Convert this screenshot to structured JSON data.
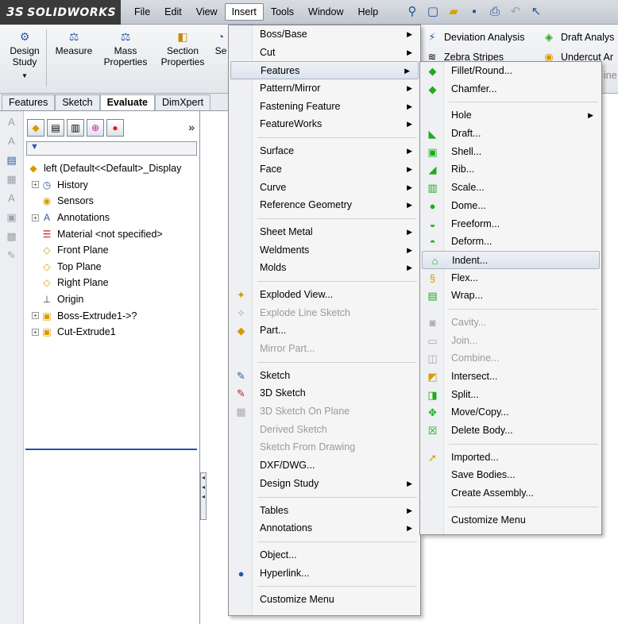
{
  "app": {
    "logo": "SOLIDWORKS",
    "logo_mark": "3S"
  },
  "menubar": [
    "File",
    "Edit",
    "View",
    "Insert",
    "Tools",
    "Window",
    "Help"
  ],
  "active_menu": "Insert",
  "commands": [
    {
      "label": "Design\nStudy"
    },
    {
      "label": "Measure"
    },
    {
      "label": "Mass\nProperties"
    },
    {
      "label": "Section\nProperties"
    },
    {
      "label": "Se"
    }
  ],
  "right_commands": {
    "deviation": "Deviation Analysis",
    "draft": "Draft Analys",
    "zebra": "Zebra Stripes",
    "undercut": "Undercut Ar",
    "partial": "ine"
  },
  "tabs": [
    "Features",
    "Sketch",
    "Evaluate",
    "DimXpert"
  ],
  "active_tab": "Evaluate",
  "fm_more": "»",
  "tree": [
    {
      "label": "left  (Default<<Default>_Display",
      "expander": "",
      "icon": "part-icon"
    },
    {
      "label": "History",
      "expander": "+",
      "icon": "history-icon"
    },
    {
      "label": "Sensors",
      "expander": "",
      "icon": "sensors-icon"
    },
    {
      "label": "Annotations",
      "expander": "+",
      "icon": "annotations-icon"
    },
    {
      "label": "Material <not specified>",
      "expander": "",
      "icon": "material-icon"
    },
    {
      "label": "Front Plane",
      "expander": "",
      "icon": "plane-icon"
    },
    {
      "label": "Top Plane",
      "expander": "",
      "icon": "plane-icon"
    },
    {
      "label": "Right Plane",
      "expander": "",
      "icon": "plane-icon"
    },
    {
      "label": "Origin",
      "expander": "",
      "icon": "origin-icon"
    },
    {
      "label": "Boss-Extrude1->?",
      "expander": "+",
      "icon": "boss-extrude-icon"
    },
    {
      "label": "Cut-Extrude1",
      "expander": "+",
      "icon": "cut-extrude-icon"
    }
  ],
  "insert_menu": [
    {
      "label": "Boss/Base",
      "submenu": true
    },
    {
      "label": "Cut",
      "submenu": true
    },
    {
      "label": "Features",
      "submenu": true,
      "highlight": true
    },
    {
      "label": "Pattern/Mirror",
      "submenu": true
    },
    {
      "label": "Fastening Feature",
      "submenu": true
    },
    {
      "label": "FeatureWorks",
      "submenu": true
    },
    {
      "sep": true
    },
    {
      "label": "Surface",
      "submenu": true
    },
    {
      "label": "Face",
      "submenu": true
    },
    {
      "label": "Curve",
      "submenu": true
    },
    {
      "label": "Reference Geometry",
      "submenu": true
    },
    {
      "sep": true
    },
    {
      "label": "Sheet Metal",
      "submenu": true
    },
    {
      "label": "Weldments",
      "submenu": true
    },
    {
      "label": "Molds",
      "submenu": true
    },
    {
      "sep": true
    },
    {
      "label": "Exploded View...",
      "icon": "exploded-view-icon"
    },
    {
      "label": "Explode Line Sketch",
      "disabled": true,
      "icon": "explode-line-icon"
    },
    {
      "label": "Part...",
      "icon": "part-insert-icon"
    },
    {
      "label": "Mirror Part...",
      "disabled": true
    },
    {
      "sep": true
    },
    {
      "label": "Sketch",
      "icon": "sketch-icon"
    },
    {
      "label": "3D Sketch",
      "icon": "3d-sketch-icon"
    },
    {
      "label": "3D Sketch On Plane",
      "disabled": true,
      "icon": "3d-sketch-plane-icon"
    },
    {
      "label": "Derived Sketch",
      "disabled": true
    },
    {
      "label": "Sketch From Drawing",
      "disabled": true
    },
    {
      "label": "DXF/DWG..."
    },
    {
      "label": "Design Study",
      "submenu": true
    },
    {
      "sep": true
    },
    {
      "label": "Tables",
      "submenu": true
    },
    {
      "label": "Annotations",
      "submenu": true
    },
    {
      "sep": true
    },
    {
      "label": "Object..."
    },
    {
      "label": "Hyperlink...",
      "icon": "hyperlink-icon"
    },
    {
      "sep": true
    },
    {
      "label": "Customize Menu"
    }
  ],
  "features_menu": [
    {
      "label": "Fillet/Round...",
      "icon": "fillet-icon"
    },
    {
      "label": "Chamfer...",
      "icon": "chamfer-icon"
    },
    {
      "sep": true
    },
    {
      "label": "Hole",
      "submenu": true
    },
    {
      "label": "Draft...",
      "icon": "draft-icon"
    },
    {
      "label": "Shell...",
      "icon": "shell-icon"
    },
    {
      "label": "Rib...",
      "icon": "rib-icon"
    },
    {
      "label": "Scale...",
      "icon": "scale-icon"
    },
    {
      "label": "Dome...",
      "icon": "dome-icon"
    },
    {
      "label": "Freeform...",
      "icon": "freeform-icon"
    },
    {
      "label": "Deform...",
      "icon": "deform-icon"
    },
    {
      "label": "Indent...",
      "icon": "indent-icon",
      "highlight": true
    },
    {
      "label": "Flex...",
      "icon": "flex-icon"
    },
    {
      "label": "Wrap...",
      "icon": "wrap-icon"
    },
    {
      "sep": true
    },
    {
      "label": "Cavity...",
      "disabled": true,
      "icon": "cavity-icon"
    },
    {
      "label": "Join...",
      "disabled": true,
      "icon": "join-icon"
    },
    {
      "label": "Combine...",
      "disabled": true,
      "icon": "combine-icon"
    },
    {
      "label": "Intersect...",
      "icon": "intersect-icon"
    },
    {
      "label": "Split...",
      "icon": "split-icon"
    },
    {
      "label": "Move/Copy...",
      "icon": "move-copy-icon"
    },
    {
      "label": "Delete Body...",
      "icon": "delete-body-icon"
    },
    {
      "sep": true
    },
    {
      "label": "Imported...",
      "icon": "imported-icon"
    },
    {
      "label": "Save Bodies..."
    },
    {
      "label": "Create Assembly..."
    },
    {
      "sep": true
    },
    {
      "label": "Customize Menu"
    }
  ],
  "colors": {
    "feature_icon": "#1faa1f",
    "accent": "#2451a6",
    "menu_bg": "#f5f5f5"
  }
}
